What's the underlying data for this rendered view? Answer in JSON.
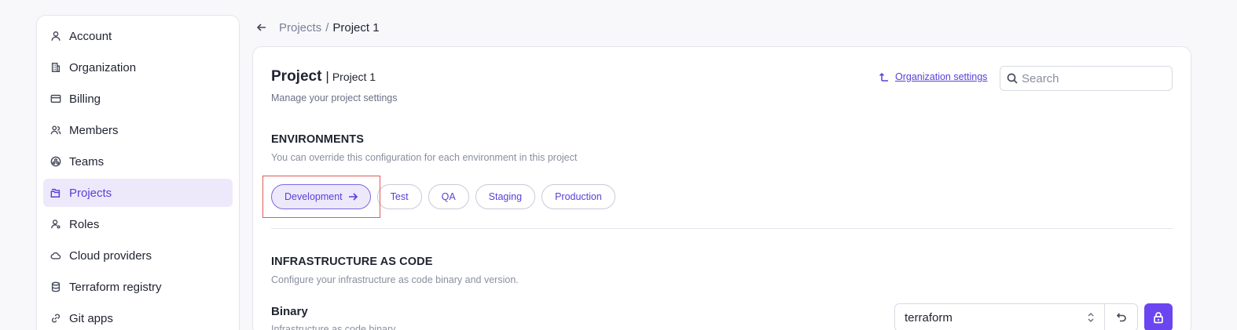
{
  "sidebar": {
    "items": [
      {
        "label": "Account",
        "icon": "user-icon"
      },
      {
        "label": "Organization",
        "icon": "building-icon"
      },
      {
        "label": "Billing",
        "icon": "credit-card-icon"
      },
      {
        "label": "Members",
        "icon": "users-icon"
      },
      {
        "label": "Teams",
        "icon": "team-icon"
      },
      {
        "label": "Projects",
        "icon": "folders-icon",
        "active": true
      },
      {
        "label": "Roles",
        "icon": "user-key-icon"
      },
      {
        "label": "Cloud providers",
        "icon": "cloud-icon"
      },
      {
        "label": "Terraform registry",
        "icon": "database-icon"
      },
      {
        "label": "Git apps",
        "icon": "link-icon"
      }
    ]
  },
  "breadcrumb": {
    "parent": "Projects",
    "separator": "/",
    "current": "Project 1"
  },
  "header": {
    "title": "Project",
    "separator": "|",
    "project_name": "Project 1",
    "subtitle": "Manage your project settings",
    "org_settings_link": "Organization settings",
    "search_placeholder": "Search"
  },
  "environments": {
    "title": "ENVIRONMENTS",
    "description": "You can override this configuration for each environment in this project",
    "tabs": [
      {
        "label": "Development",
        "active": true
      },
      {
        "label": "Test"
      },
      {
        "label": "QA"
      },
      {
        "label": "Staging"
      },
      {
        "label": "Production"
      }
    ]
  },
  "iac": {
    "title": "INFRASTRUCTURE AS CODE",
    "description": "Configure your infrastructure as code binary and version.",
    "binary_label": "Binary",
    "binary_help": "Infrastructure as code binary",
    "binary_value": "terraform"
  },
  "colors": {
    "accent": "#6b45f0",
    "accent_text": "#5a3fd8",
    "active_bg": "#ede9fb",
    "highlight": "#e05a5a"
  }
}
